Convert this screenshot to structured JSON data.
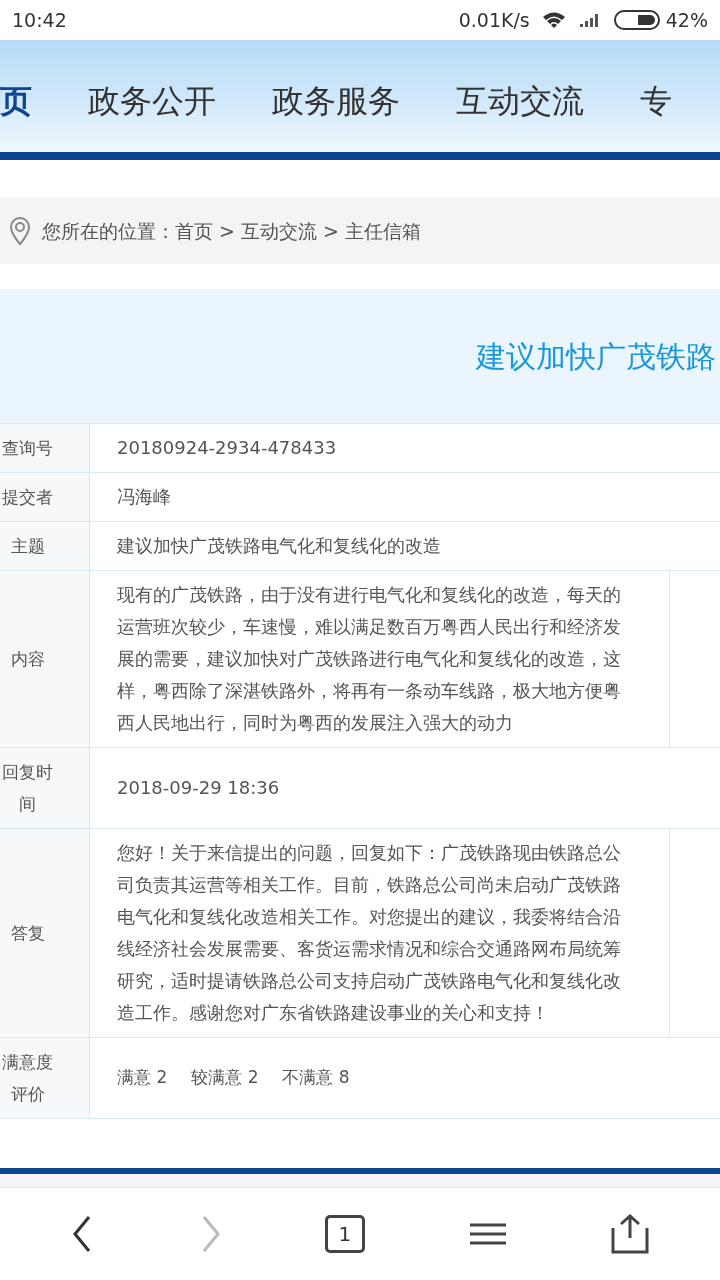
{
  "status_bar": {
    "time": "10:42",
    "network_speed": "0.01K/s",
    "battery_percent": "42%"
  },
  "nav": {
    "items": [
      {
        "label": "页",
        "selected": true
      },
      {
        "label": "政务公开",
        "selected": false
      },
      {
        "label": "政务服务",
        "selected": false
      },
      {
        "label": "互动交流",
        "selected": false
      },
      {
        "label": "专",
        "selected": false
      }
    ]
  },
  "breadcrumb": "您所在的位置：首页 > 互动交流 > 主任信箱",
  "title": "建议加快广茂铁路",
  "rows": [
    {
      "kind": "short",
      "label": "查询号",
      "value": "20180924-2934-478433"
    },
    {
      "kind": "short",
      "label": "提交者",
      "value": "冯海峰"
    },
    {
      "kind": "short",
      "label": "主题",
      "value": "建议加快广茂铁路电气化和复线化的改造"
    },
    {
      "kind": "long",
      "label": "内容",
      "value": "现有的广茂铁路，由于没有进行电气化和复线化的改造，每天的运营班次较少，车速慢，难以满足数百万粤西人民出行和经济发展的需要，建议加快对广茂铁路进行电气化和复线化的改造，这样，粤西除了深湛铁路外，将再有一条动车线路，极大地方便粤西人民地出行，同时为粤西的发展注入强大的动力"
    },
    {
      "kind": "short",
      "label": "回复时间",
      "value": "2018-09-29 18:36"
    },
    {
      "kind": "long",
      "label": "答复",
      "value": "您好！关于来信提出的问题，回复如下：广茂铁路现由铁路总公司负责其运营等相关工作。目前，铁路总公司尚未启动广茂铁路电气化和复线化改造相关工作。对您提出的建议，我委将结合沿线经济社会发展需要、客货运需求情况和综合交通路网布局统筹研究，适时提请铁路总公司支持启动广茂铁路电气化和复线化改造工作。感谢您对广东省铁路建设事业的关心和支持！"
    },
    {
      "kind": "ratings",
      "label": "满意度评价",
      "ratings": [
        "满意 2",
        "较满意 2",
        "不满意 8"
      ]
    }
  ],
  "browser_toolbar": {
    "back_enabled": true,
    "forward_enabled": false,
    "tab_count": "1"
  }
}
